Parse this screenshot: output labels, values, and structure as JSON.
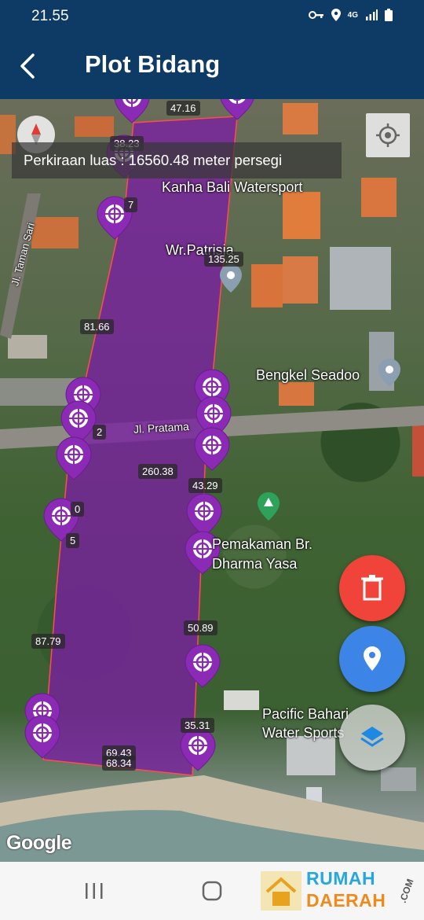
{
  "status_bar": {
    "time": "21.55",
    "network": "4G"
  },
  "app_bar": {
    "title": "Plot Bidang"
  },
  "map": {
    "area_banner": "Perkiraan luas : 16560.48 meter persegi",
    "places": [
      {
        "name": "Kanha Bali Watersport"
      },
      {
        "name": "Wr.Patrisia"
      },
      {
        "name": "Bengkel Seadoo"
      },
      {
        "name": "Jl. Pratama"
      },
      {
        "name": "Jl. Taman Sari"
      },
      {
        "name": "Pemakaman Br.\nDharma Yasa"
      },
      {
        "name": "Pacific Bahari\nWater Sports"
      }
    ],
    "segment_labels": [
      "47.16",
      "38.23",
      "7",
      "135.25",
      "81.66",
      "2",
      "260.38",
      "43.29",
      "0",
      "5",
      "50.89",
      "87.79",
      "35.31",
      "69.43",
      "68.34"
    ],
    "google_logo": "Google"
  },
  "watermark": {
    "line1": "RUMAH",
    "line2": "DAERAH",
    "suffix": ".COM"
  },
  "colors": {
    "app_bar": "#0e3a66",
    "polygon_fill": "#7a1fa2",
    "marker": "#8b2bb5",
    "fab_delete": "#f0433a",
    "fab_marker": "#3c84e6"
  }
}
